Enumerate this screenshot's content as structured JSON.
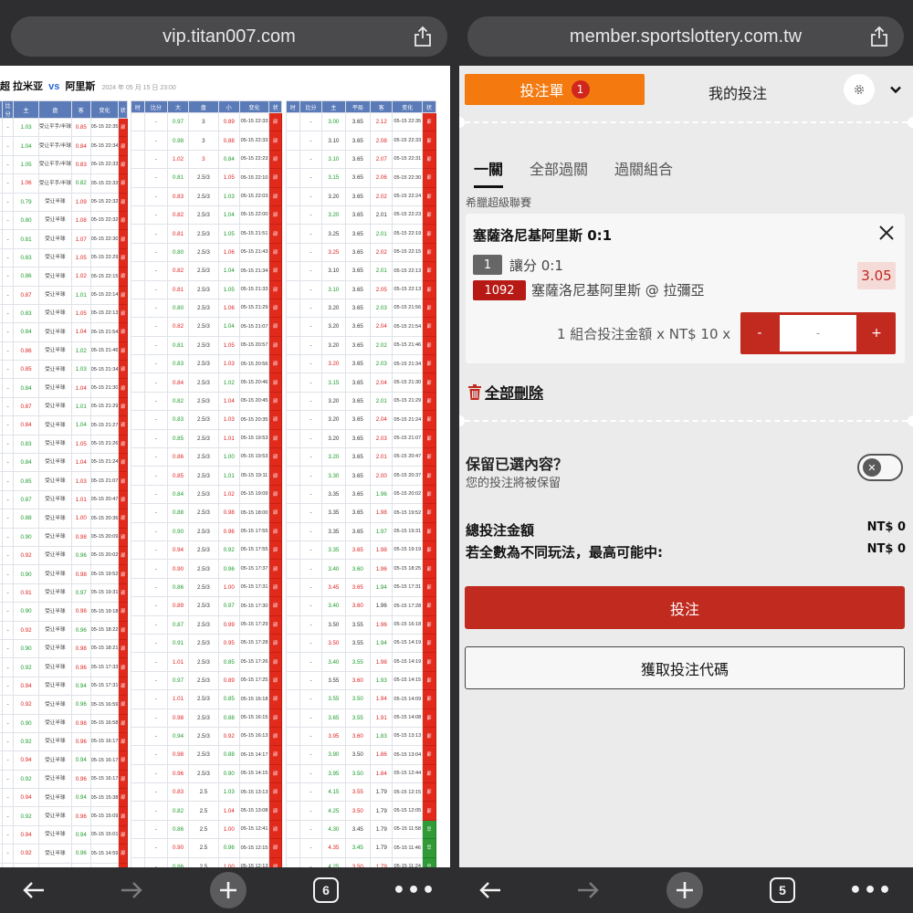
{
  "browser": {
    "left_url": "vip.titan007.com",
    "right_url": "member.sportslottery.com.tw",
    "left_tab_count": "6",
    "right_tab_count": "5"
  },
  "odds_page": {
    "title_home": "超 拉米亚",
    "vs": "vs",
    "title_away": "阿里斯",
    "date": "2024 年 05 月 15 日 23:00",
    "asian_headers": [
      "比分",
      "主",
      "盘",
      "客",
      "变化",
      "状"
    ],
    "ou_headers": [
      "时",
      "比分",
      "大",
      "盘",
      "小",
      "变化",
      "状"
    ],
    "eu_headers": [
      "时",
      "比分",
      "主",
      "平局",
      "客",
      "变化",
      "状"
    ],
    "status_label": "即",
    "status_label_alt": "早",
    "asian_rows": [
      [
        "-",
        "1.03",
        "受让平手/半球",
        "0.85",
        "05-15 22:35"
      ],
      [
        "-",
        "1.04",
        "受让平手/半球",
        "0.84",
        "05-15 22:34"
      ],
      [
        "-",
        "1.05",
        "受让平手/半球",
        "0.83",
        "05-15 22:33"
      ],
      [
        "-",
        "1.06",
        "受让平手/半球",
        "0.82",
        "05-15 22:33"
      ],
      [
        "-",
        "0.79",
        "受让半球",
        "1.09",
        "05-15 22:32"
      ],
      [
        "-",
        "0.80",
        "受让半球",
        "1.08",
        "05-15 22:32"
      ],
      [
        "-",
        "0.81",
        "受让半球",
        "1.07",
        "05-15 22:30"
      ],
      [
        "-",
        "0.83",
        "受让半球",
        "1.05",
        "05-15 22:29"
      ],
      [
        "-",
        "0.86",
        "受让半球",
        "1.02",
        "05-15 22:15"
      ],
      [
        "-",
        "0.87",
        "受让半球",
        "1.01",
        "05-15 22:14"
      ],
      [
        "-",
        "0.83",
        "受让半球",
        "1.05",
        "05-15 22:13"
      ],
      [
        "-",
        "0.84",
        "受让半球",
        "1.04",
        "05-15 21:54"
      ],
      [
        "-",
        "0.86",
        "受让半球",
        "1.02",
        "05-15 21:46"
      ],
      [
        "-",
        "0.85",
        "受让半球",
        "1.03",
        "05-15 21:34"
      ],
      [
        "-",
        "0.84",
        "受让半球",
        "1.04",
        "05-15 21:30"
      ],
      [
        "-",
        "0.87",
        "受让半球",
        "1.01",
        "05-15 21:29"
      ],
      [
        "-",
        "0.84",
        "受让半球",
        "1.04",
        "05-15 21:27"
      ],
      [
        "-",
        "0.83",
        "受让半球",
        "1.05",
        "05-15 21:26"
      ],
      [
        "-",
        "0.84",
        "受让半球",
        "1.04",
        "05-15 21:24"
      ],
      [
        "-",
        "0.85",
        "受让半球",
        "1.03",
        "05-15 21:07"
      ],
      [
        "-",
        "0.87",
        "受让半球",
        "1.01",
        "05-15 20:47"
      ],
      [
        "-",
        "0.88",
        "受让半球",
        "1.00",
        "05-15 20:36"
      ],
      [
        "-",
        "0.90",
        "受让半球",
        "0.98",
        "05-15 20:09"
      ],
      [
        "-",
        "0.92",
        "受让半球",
        "0.96",
        "05-15 20:02"
      ],
      [
        "-",
        "0.90",
        "受让半球",
        "0.98",
        "05-15 19:52"
      ],
      [
        "-",
        "0.91",
        "受让半球",
        "0.97",
        "05-15 19:31"
      ],
      [
        "-",
        "0.90",
        "受让半球",
        "0.98",
        "05-15 19:18"
      ],
      [
        "-",
        "0.92",
        "受让半球",
        "0.96",
        "05-15 18:22"
      ],
      [
        "-",
        "0.90",
        "受让半球",
        "0.98",
        "05-15 18:21"
      ],
      [
        "-",
        "0.92",
        "受让半球",
        "0.96",
        "05-15 17:33"
      ],
      [
        "-",
        "0.94",
        "受让半球",
        "0.94",
        "05-15 17:31"
      ],
      [
        "-",
        "0.92",
        "受让半球",
        "0.96",
        "05-15 16:59"
      ],
      [
        "-",
        "0.90",
        "受让半球",
        "0.98",
        "05-15 16:58"
      ],
      [
        "-",
        "0.92",
        "受让半球",
        "0.96",
        "05-15 16:17"
      ],
      [
        "-",
        "0.94",
        "受让半球",
        "0.94",
        "05-15 16:17"
      ],
      [
        "-",
        "0.92",
        "受让半球",
        "0.96",
        "05-15 16:17"
      ],
      [
        "-",
        "0.94",
        "受让半球",
        "0.94",
        "05-15 15:38"
      ],
      [
        "-",
        "0.92",
        "受让半球",
        "0.96",
        "05-15 15:09"
      ],
      [
        "-",
        "0.94",
        "受让半球",
        "0.94",
        "05-15 15:01"
      ],
      [
        "-",
        "0.92",
        "受让半球",
        "0.96",
        "05-15 14:59"
      ],
      [
        "-",
        "0.90",
        "受让半球",
        "0.98",
        "05-15 14:59"
      ],
      [
        "-",
        "0.92",
        "受让半球",
        "0.96",
        "05-15 14:27"
      ],
      [
        "-",
        "0.94",
        "受让半球",
        "0.94",
        "05-15 14:19"
      ],
      [
        "-",
        "0.93",
        "受让半球",
        "0.95",
        "05-15 14:18"
      ]
    ],
    "ou_rows": [
      [
        "-",
        "0.97",
        "3",
        "0.89",
        "05-15 22:33"
      ],
      [
        "-",
        "0.98",
        "3",
        "0.88",
        "05-15 22:33"
      ],
      [
        "-",
        "1.02",
        "3",
        "0.84",
        "05-15 22:23"
      ],
      [
        "-",
        "0.81",
        "2.5/3",
        "1.05",
        "05-15 22:10"
      ],
      [
        "-",
        "0.83",
        "2.5/3",
        "1.03",
        "05-15 22:03"
      ],
      [
        "-",
        "0.82",
        "2.5/3",
        "1.04",
        "05-15 22:00"
      ],
      [
        "-",
        "0.81",
        "2.5/3",
        "1.05",
        "05-15 21:51"
      ],
      [
        "-",
        "0.80",
        "2.5/3",
        "1.06",
        "05-15 21:43"
      ],
      [
        "-",
        "0.82",
        "2.5/3",
        "1.04",
        "05-15 21:34"
      ],
      [
        "-",
        "0.81",
        "2.5/3",
        "1.05",
        "05-15 21:33"
      ],
      [
        "-",
        "0.80",
        "2.5/3",
        "1.06",
        "05-15 21:29"
      ],
      [
        "-",
        "0.82",
        "2.5/3",
        "1.04",
        "05-15 21:07"
      ],
      [
        "-",
        "0.81",
        "2.5/3",
        "1.05",
        "05-15 20:57"
      ],
      [
        "-",
        "0.83",
        "2.5/3",
        "1.03",
        "05-15 20:56"
      ],
      [
        "-",
        "0.84",
        "2.5/3",
        "1.02",
        "05-15 20:46"
      ],
      [
        "-",
        "0.82",
        "2.5/3",
        "1.04",
        "05-15 20:45"
      ],
      [
        "-",
        "0.83",
        "2.5/3",
        "1.03",
        "05-15 20:35"
      ],
      [
        "-",
        "0.85",
        "2.5/3",
        "1.01",
        "05-15 19:53"
      ],
      [
        "-",
        "0.86",
        "2.5/3",
        "1.00",
        "05-15 19:53"
      ],
      [
        "-",
        "0.85",
        "2.5/3",
        "1.01",
        "05-15 19:11"
      ],
      [
        "-",
        "0.84",
        "2.5/3",
        "1.02",
        "05-15 19:09"
      ],
      [
        "-",
        "0.88",
        "2.5/3",
        "0.98",
        "05-15 18:00"
      ],
      [
        "-",
        "0.90",
        "2.5/3",
        "0.96",
        "05-15 17:55"
      ],
      [
        "-",
        "0.94",
        "2.5/3",
        "0.92",
        "05-15 17:55"
      ],
      [
        "-",
        "0.90",
        "2.5/3",
        "0.96",
        "05-15 17:37"
      ],
      [
        "-",
        "0.86",
        "2.5/3",
        "1.00",
        "05-15 17:31"
      ],
      [
        "-",
        "0.89",
        "2.5/3",
        "0.97",
        "05-15 17:30"
      ],
      [
        "-",
        "0.87",
        "2.5/3",
        "0.99",
        "05-15 17:29"
      ],
      [
        "-",
        "0.91",
        "2.5/3",
        "0.95",
        "05-15 17:28"
      ],
      [
        "-",
        "1.01",
        "2.5/3",
        "0.85",
        "05-15 17:26"
      ],
      [
        "-",
        "0.97",
        "2.5/3",
        "0.89",
        "05-15 17:25"
      ],
      [
        "-",
        "1.01",
        "2.5/3",
        "0.85",
        "05-15 16:18"
      ],
      [
        "-",
        "0.98",
        "2.5/3",
        "0.88",
        "05-15 16:15"
      ],
      [
        "-",
        "0.94",
        "2.5/3",
        "0.92",
        "05-15 16:13"
      ],
      [
        "-",
        "0.98",
        "2.5/3",
        "0.88",
        "05-15 14:17"
      ],
      [
        "-",
        "0.96",
        "2.5/3",
        "0.90",
        "05-15 14:15"
      ],
      [
        "-",
        "0.83",
        "2.5",
        "1.03",
        "05-15 13:13"
      ],
      [
        "-",
        "0.82",
        "2.5",
        "1.04",
        "05-15 13:08"
      ],
      [
        "-",
        "0.86",
        "2.5",
        "1.00",
        "05-15 12:41"
      ],
      [
        "-",
        "0.90",
        "2.5",
        "0.96",
        "05-15 12:15"
      ],
      [
        "-",
        "0.86",
        "2.5",
        "1.00",
        "05-15 12:13"
      ],
      [
        "-",
        "0.94",
        "2.5",
        "0.92",
        "05-15 12:11"
      ],
      [
        "-",
        "0.98",
        "2.5",
        "0.88",
        "05-15 12:05"
      ],
      [
        "-",
        "1.02",
        "2.5",
        "0.84",
        "05-15 12:05"
      ],
      [
        "-",
        "0.98",
        "2.5",
        "0.88",
        "05-15 12:03"
      ]
    ],
    "eu_rows": [
      [
        "-",
        "3.00",
        "3.65",
        "2.12",
        "05-15 22:35"
      ],
      [
        "-",
        "3.10",
        "3.65",
        "2.08",
        "05-15 22:33"
      ],
      [
        "-",
        "3.10",
        "3.65",
        "2.07",
        "05-15 22:31"
      ],
      [
        "-",
        "3.15",
        "3.65",
        "2.06",
        "05-15 22:30"
      ],
      [
        "-",
        "3.20",
        "3.65",
        "2.02",
        "05-15 22:24"
      ],
      [
        "-",
        "3.20",
        "3.65",
        "2.01",
        "05-15 22:23"
      ],
      [
        "-",
        "3.25",
        "3.65",
        "2.01",
        "05-15 22:19"
      ],
      [
        "-",
        "3.25",
        "3.65",
        "2.02",
        "05-15 22:15"
      ],
      [
        "-",
        "3.10",
        "3.65",
        "2.01",
        "05-15 22:13"
      ],
      [
        "-",
        "3.10",
        "3.65",
        "2.05",
        "05-15 22:13"
      ],
      [
        "-",
        "3.20",
        "3.65",
        "2.03",
        "05-15 21:56"
      ],
      [
        "-",
        "3.20",
        "3.65",
        "2.04",
        "05-15 21:54"
      ],
      [
        "-",
        "3.20",
        "3.65",
        "2.02",
        "05-15 21:46"
      ],
      [
        "-",
        "3.20",
        "3.65",
        "2.03",
        "05-15 21:34"
      ],
      [
        "-",
        "3.15",
        "3.65",
        "2.04",
        "05-15 21:30"
      ],
      [
        "-",
        "3.20",
        "3.65",
        "2.01",
        "05-15 21:29"
      ],
      [
        "-",
        "3.20",
        "3.65",
        "2.04",
        "05-15 21:24"
      ],
      [
        "-",
        "3.20",
        "3.65",
        "2.03",
        "05-15 21:07"
      ],
      [
        "-",
        "3.20",
        "3.65",
        "2.01",
        "05-15 20:47"
      ],
      [
        "-",
        "3.30",
        "3.65",
        "2.00",
        "05-15 20:37"
      ],
      [
        "-",
        "3.35",
        "3.65",
        "1.96",
        "05-15 20:02"
      ],
      [
        "-",
        "3.35",
        "3.65",
        "1.98",
        "05-15 19:52"
      ],
      [
        "-",
        "3.35",
        "3.65",
        "1.97",
        "05-15 19:31"
      ],
      [
        "-",
        "3.35",
        "3.65",
        "1.98",
        "05-15 19:19"
      ],
      [
        "-",
        "3.40",
        "3.60",
        "1.96",
        "05-15 18:25"
      ],
      [
        "-",
        "3.45",
        "3.65",
        "1.94",
        "05-15 17:31"
      ],
      [
        "-",
        "3.40",
        "3.60",
        "1.96",
        "05-15 17:28"
      ],
      [
        "-",
        "3.50",
        "3.55",
        "1.96",
        "05-15 16:18"
      ],
      [
        "-",
        "3.50",
        "3.55",
        "1.94",
        "05-15 14:19"
      ],
      [
        "-",
        "3.40",
        "3.55",
        "1.98",
        "05-15 14:19"
      ],
      [
        "-",
        "3.55",
        "3.60",
        "1.93",
        "05-15 14:15"
      ],
      [
        "-",
        "3.55",
        "3.50",
        "1.94",
        "05-15 14:09"
      ],
      [
        "-",
        "3.65",
        "3.55",
        "1.91",
        "05-15 14:08"
      ],
      [
        "-",
        "3.95",
        "3.60",
        "1.83",
        "05-15 13:13"
      ],
      [
        "-",
        "3.90",
        "3.50",
        "1.86",
        "05-15 13:04"
      ],
      [
        "-",
        "3.95",
        "3.50",
        "1.84",
        "05-15 12:44"
      ],
      [
        "-",
        "4.15",
        "3.55",
        "1.79",
        "05-15 12:15"
      ],
      [
        "-",
        "4.25",
        "3.50",
        "1.79",
        "05-15 12:05"
      ],
      [
        "-",
        "4.30",
        "3.45",
        "1.79",
        "05-15 11:58"
      ],
      [
        "-",
        "4.35",
        "3.45",
        "1.79",
        "05-15 11:46"
      ],
      [
        "-",
        "4.25",
        "3.50",
        "1.79",
        "05-15 11:24"
      ],
      [
        "-",
        "4.65",
        "3.45",
        "1.74",
        "05-15 06:20"
      ],
      [
        "-",
        "4.60",
        "3.50",
        "1.73",
        "05-15 04:50"
      ],
      [
        "-",
        "4.50",
        "3.55",
        "1.73",
        "05-15 01:16"
      ],
      [
        "-",
        "4.45",
        "3.60",
        "1.73",
        "05-15 00:42"
      ]
    ]
  },
  "bet_slip": {
    "slip_tab_label": "投注單",
    "slip_count": "1",
    "my_bets_label": "我的投注",
    "tabs": [
      "一關",
      "全部過關",
      "過關組合"
    ],
    "league": "希臘超級聯賽",
    "bet": {
      "title": "塞薩洛尼基阿里斯 0:1",
      "market_no": "1",
      "market": "讓分 0:1",
      "code": "1092",
      "selection": "塞薩洛尼基阿里斯 @ 拉彌亞",
      "odds": "3.05",
      "stake_label": "1 組合投注金額 x NT$ 10 x",
      "stake_minus": "-",
      "stake_value": "-",
      "stake_plus": "+"
    },
    "delete_all": "全部刪除",
    "keep_title": "保留已選內容？",
    "keep_sub": "您的投注將被保留",
    "toggle_knob": "✕",
    "total_label": "總投注金額",
    "total_value": "NT$ 0",
    "max_win_label": "若全數為不同玩法，最高可能中:",
    "max_win_value": "NT$ 0",
    "submit_label": "投注",
    "code_label": "獲取投注代碼"
  },
  "colors": {
    "accent_red": "#c02a1f",
    "orange": "#f47a10",
    "status_red": "#e12a1c",
    "status_green": "#2f9a36",
    "header_blue": "#5b7bb8"
  },
  "icons": [
    "share-icon",
    "back-arrow-icon",
    "forward-arrow-icon",
    "plus-icon",
    "tabs-icon",
    "more-icon",
    "gear-icon",
    "chevron-down-icon",
    "close-icon",
    "trash-icon"
  ]
}
